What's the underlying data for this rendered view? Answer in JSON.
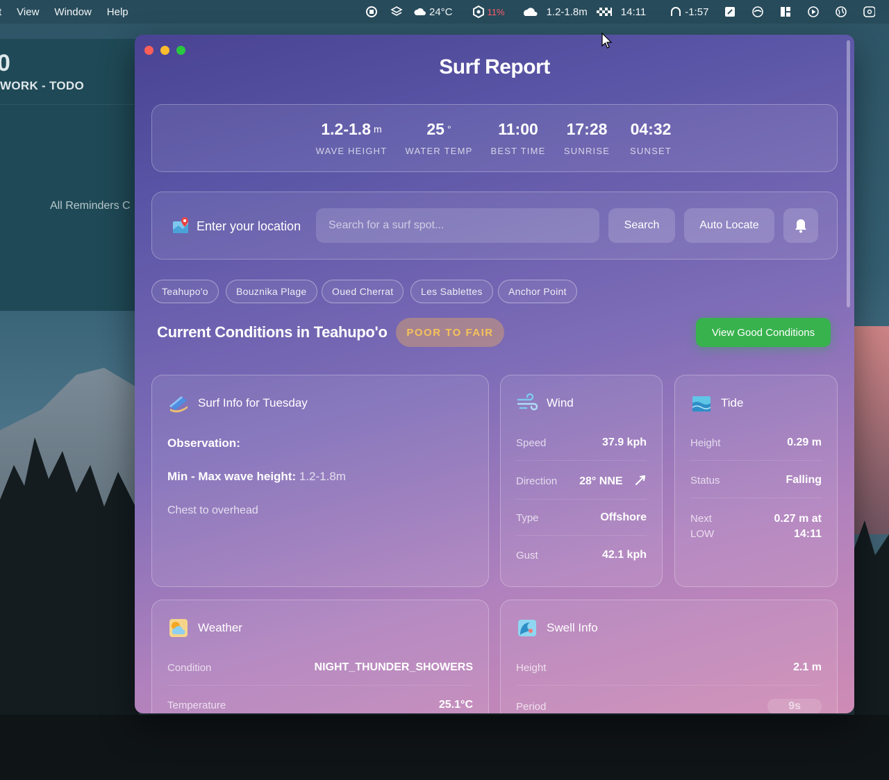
{
  "menubar": {
    "items": [
      "t",
      "View",
      "Window",
      "Help"
    ],
    "weather_temp": "24°C",
    "vpn_percent": "11%",
    "surf_height": "1.2-1.8m",
    "time": "14:11",
    "countdown": "-1:57",
    "colors": {
      "vpn": "#ff5b6b"
    }
  },
  "bg_window": {
    "big_char": "0",
    "list_title": "WORK - TODO",
    "all_reminders": "All Reminders C"
  },
  "app": {
    "title": "Surf Report",
    "stats": [
      {
        "value": "1.2-1.8",
        "unit": "m",
        "label": "WAVE HEIGHT"
      },
      {
        "value": "25",
        "unit": "°",
        "label": "WATER TEMP"
      },
      {
        "value": "11:00",
        "unit": "",
        "label": "BEST TIME"
      },
      {
        "value": "17:28",
        "unit": "",
        "label": "SUNRISE"
      },
      {
        "value": "04:32",
        "unit": "",
        "label": "SUNSET"
      }
    ],
    "location": {
      "label": "Enter your location",
      "placeholder": "Search for a surf spot...",
      "search_label": "Search",
      "auto_locate_label": "Auto Locate"
    },
    "spots": [
      "Teahupo'o",
      "Bouznika Plage",
      "Oued Cherrat",
      "Les Sablettes",
      "Anchor Point"
    ],
    "conditions": {
      "title": "Current Conditions in Teahupo'o",
      "rating": "POOR TO FAIR",
      "good_button": "View Good Conditions"
    },
    "surf_info": {
      "title": "Surf Info for Tuesday",
      "observation_label": "Observation:",
      "minmax_label": "Min - Max wave height:",
      "minmax_value": "1.2-1.8m",
      "description": "Chest to overhead"
    },
    "wind": {
      "title": "Wind",
      "rows": [
        {
          "k": "Speed",
          "v": "37.9 kph"
        },
        {
          "k": "Direction",
          "v": "28° NNE"
        },
        {
          "k": "Type",
          "v": "Offshore"
        },
        {
          "k": "Gust",
          "v": "42.1 kph"
        }
      ]
    },
    "tide": {
      "title": "Tide",
      "rows": [
        {
          "k": "Height",
          "v": "0.29 m"
        },
        {
          "k": "Status",
          "v": "Falling"
        }
      ],
      "next_label_1": "Next",
      "next_label_2": "LOW",
      "next_value_1": "0.27 m at",
      "next_value_2": "14:11"
    },
    "weather": {
      "title": "Weather",
      "rows": [
        {
          "k": "Condition",
          "v": "NIGHT_THUNDER_SHOWERS"
        },
        {
          "k": "Temperature",
          "v": "25.1°C"
        }
      ]
    },
    "swell": {
      "title": "Swell Info",
      "rows": [
        {
          "k": "Height",
          "v": "2.1 m"
        },
        {
          "k": "Period",
          "v": "9s"
        }
      ]
    },
    "colors": {
      "good_button": "#37b24d",
      "rating_text": "#f6c25a"
    }
  }
}
